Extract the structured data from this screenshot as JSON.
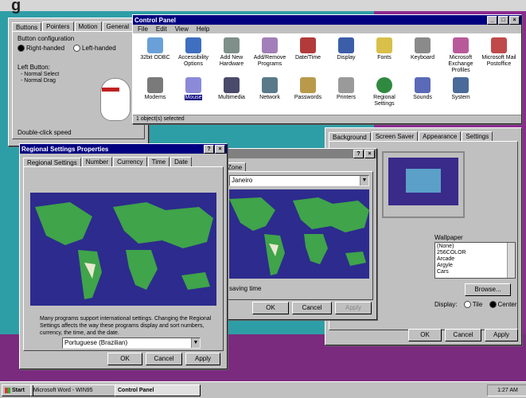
{
  "mouse_props": {
    "tabs": [
      "Buttons",
      "Pointers",
      "Motion",
      "General"
    ],
    "button_config_label": "Button configuration",
    "right_handed": "Right-handed",
    "left_handed": "Left-handed",
    "left_button_label": "Left Button:",
    "normal_select": "- Normal Select",
    "normal_drag": "- Normal Drag",
    "double_click": "Double-click speed"
  },
  "control_panel": {
    "title": "Control Panel",
    "menu": [
      "File",
      "Edit",
      "View",
      "Help"
    ],
    "icons": [
      "32bit ODBC",
      "Accessibility Options",
      "Add New Hardware",
      "Add/Remove Programs",
      "Date/Time",
      "Display",
      "Fonts",
      "Keyboard",
      "Microsoft Exchange Profiles",
      "Microsoft Mail Postoffice",
      "Modems",
      "Mouse",
      "Multimedia",
      "Network",
      "Passwords",
      "Printers",
      "Regional Settings",
      "Sounds",
      "System"
    ],
    "status": "1 object(s) selected"
  },
  "regional": {
    "title": "Regional Settings Properties",
    "tabs": [
      "Regional Settings",
      "Number",
      "Currency",
      "Time",
      "Date"
    ],
    "description": "Many programs support international settings. Changing the Regional Settings affects the way these programs display and sort numbers, currency, the time, and the date.",
    "locale": "Portuguese (Brazilian)",
    "ok": "OK",
    "cancel": "Cancel",
    "apply": "Apply"
  },
  "datetime": {
    "tab": "Zone",
    "field": "Janeiro",
    "saving_time": "saving time",
    "ok": "OK",
    "cancel": "Cancel",
    "apply": "Apply"
  },
  "display": {
    "tabs": [
      "Background",
      "Screen Saver",
      "Appearance",
      "Settings"
    ],
    "wallpaper_label": "Wallpaper",
    "wallpaper_items": [
      "(None)",
      "256COLOR",
      "Arcade",
      "Argyle",
      "Cars"
    ],
    "browse": "Browse...",
    "display_label": "Display:",
    "tile": "Tile",
    "center": "Center",
    "ok": "OK",
    "cancel": "Cancel",
    "apply": "Apply"
  },
  "taskbar": {
    "start": "Start",
    "items": [
      "Microsoft Word - WIN95",
      "Control Panel"
    ],
    "clock": "1:27 AM"
  },
  "colors": {
    "desktop": "#2e9ea6",
    "titlebar": "#000080",
    "map_ocean": "#2d2b8d",
    "map_land": "#3fa44a"
  }
}
